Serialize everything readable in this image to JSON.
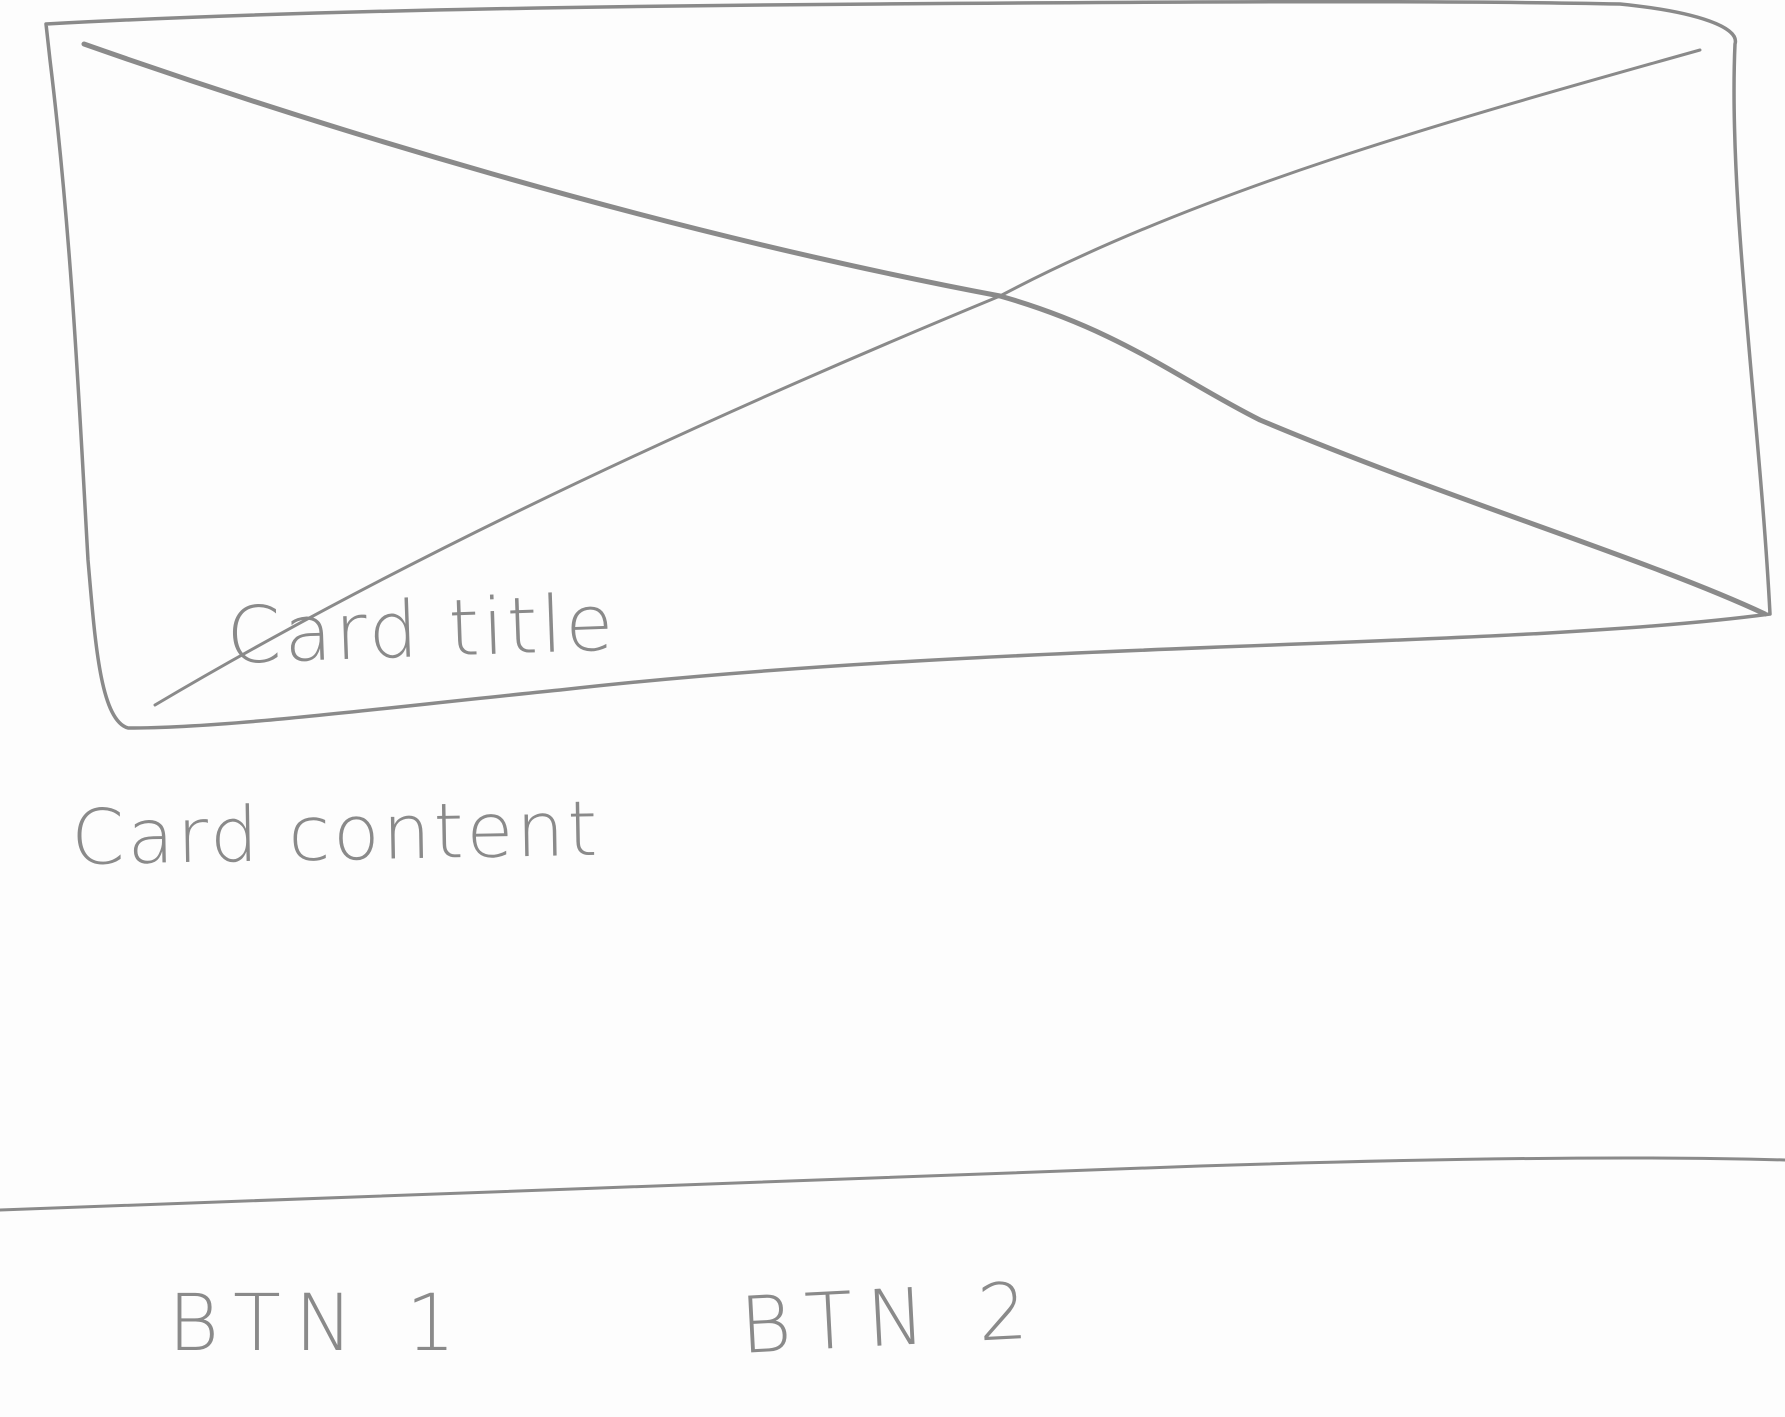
{
  "card": {
    "title": "Card title",
    "content": "Card content",
    "image_placeholder_icon": "image-placeholder-x-icon"
  },
  "actions": {
    "button_1_label": "BTN 1",
    "button_2_label": "BTN 2"
  },
  "colors": {
    "pencil": "#8a8a8a",
    "paper": "#fdfdfd"
  }
}
